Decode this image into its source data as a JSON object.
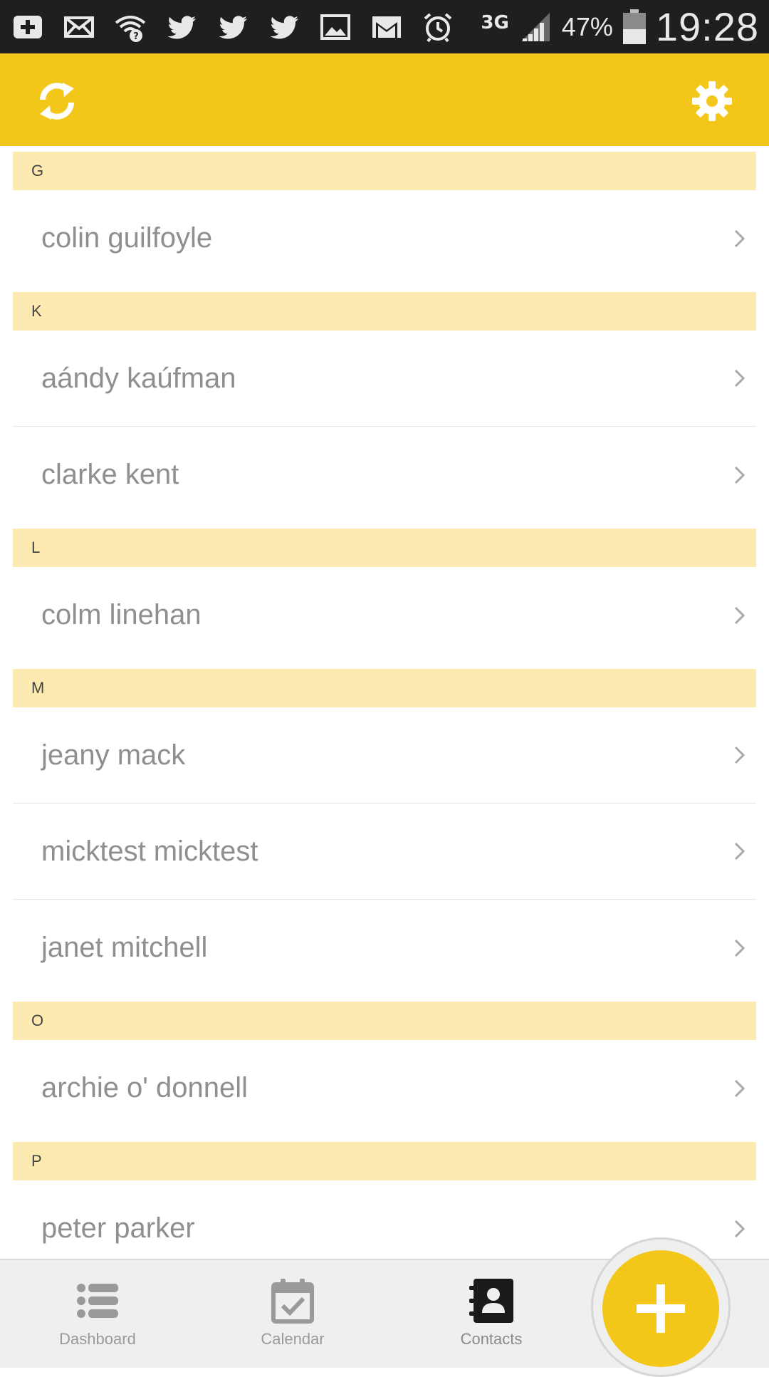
{
  "status_bar": {
    "icons": [
      "plus-box-icon",
      "mail-x-icon",
      "wifi-question-icon",
      "twitter-icon",
      "twitter-icon",
      "twitter-icon",
      "image-icon",
      "gmail-icon",
      "alarm-icon"
    ],
    "network": "3G",
    "battery_percent": "47%",
    "battery_level": 0.47,
    "time": "19:28"
  },
  "app_bar": {
    "accent_color": "#f2c71a",
    "left_action": "sync-icon",
    "right_action": "gear-icon"
  },
  "contacts": {
    "sections": [
      {
        "letter": "G",
        "items": [
          "colin guilfoyle"
        ]
      },
      {
        "letter": "K",
        "items": [
          "aándy kaúfman",
          "clarke kent"
        ]
      },
      {
        "letter": "L",
        "items": [
          "colm linehan"
        ]
      },
      {
        "letter": "M",
        "items": [
          "jeany mack",
          "micktest micktest",
          "janet mitchell"
        ]
      },
      {
        "letter": "O",
        "items": [
          "archie o' donnell"
        ]
      },
      {
        "letter": "P",
        "items": [
          "peter parker"
        ]
      }
    ]
  },
  "bottom_nav": {
    "tabs": [
      {
        "label": "Dashboard",
        "icon": "list-icon"
      },
      {
        "label": "Calendar",
        "icon": "calendar-check-icon"
      },
      {
        "label": "Contacts",
        "icon": "contacts-book-icon",
        "active": true
      }
    ],
    "fab_icon": "plus-icon"
  }
}
